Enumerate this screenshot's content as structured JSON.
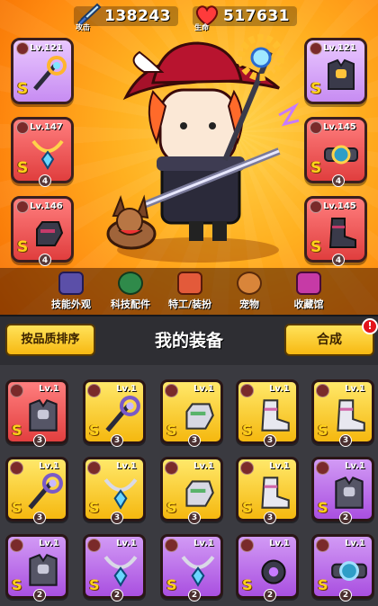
{
  "stats": {
    "attack_label": "攻击",
    "attack_value": "138243",
    "hp_label": "生命",
    "hp_value": "517631"
  },
  "equipped": [
    {
      "level": "Lv.121",
      "grade": "S",
      "stars": null
    },
    {
      "level": "Lv.121",
      "grade": "S",
      "stars": null
    },
    {
      "level": "Lv.147",
      "grade": "S",
      "stars": "4"
    },
    {
      "level": "Lv.145",
      "grade": "S",
      "stars": "4"
    },
    {
      "level": "Lv.146",
      "grade": "S",
      "stars": "4"
    },
    {
      "level": "Lv.145",
      "grade": "S",
      "stars": "4"
    }
  ],
  "menu": [
    "技能外观",
    "科技配件",
    "特工/装扮",
    "宠物",
    "收藏馆"
  ],
  "sort_button": "按品质排序",
  "section_title": "我的装备",
  "synth_button": "合成",
  "alert": "!",
  "inventory": [
    {
      "level": "Lv.1",
      "grade": "S",
      "stars": "3",
      "rarity": "red"
    },
    {
      "level": "Lv.1",
      "grade": "S",
      "stars": "3",
      "rarity": "yellow"
    },
    {
      "level": "Lv.1",
      "grade": "S",
      "stars": "3",
      "rarity": "yellow"
    },
    {
      "level": "Lv.1",
      "grade": "S",
      "stars": "3",
      "rarity": "yellow"
    },
    {
      "level": "Lv.1",
      "grade": "S",
      "stars": "3",
      "rarity": "yellow"
    },
    {
      "level": "Lv.1",
      "grade": "S",
      "stars": "3",
      "rarity": "yellow"
    },
    {
      "level": "Lv.1",
      "grade": "S",
      "stars": "3",
      "rarity": "yellow"
    },
    {
      "level": "Lv.1",
      "grade": "S",
      "stars": "3",
      "rarity": "yellow"
    },
    {
      "level": "Lv.1",
      "grade": "S",
      "stars": "3",
      "rarity": "yellow"
    },
    {
      "level": "Lv.1",
      "grade": "S",
      "stars": "2",
      "rarity": "purple"
    },
    {
      "level": "Lv.1",
      "grade": "S",
      "stars": "2",
      "rarity": "purple"
    },
    {
      "level": "Lv.1",
      "grade": "S",
      "stars": "2",
      "rarity": "purple"
    },
    {
      "level": "Lv.1",
      "grade": "S",
      "stars": "2",
      "rarity": "purple"
    },
    {
      "level": "Lv.1",
      "grade": "S",
      "stars": "2",
      "rarity": "purple"
    },
    {
      "level": "Lv.1",
      "grade": "S",
      "stars": "2",
      "rarity": "purple"
    }
  ],
  "colors": {
    "red": "#e23f3f",
    "yellow": "#f5b80f",
    "purple": "#a94fe0",
    "background": "#ff9a14"
  }
}
